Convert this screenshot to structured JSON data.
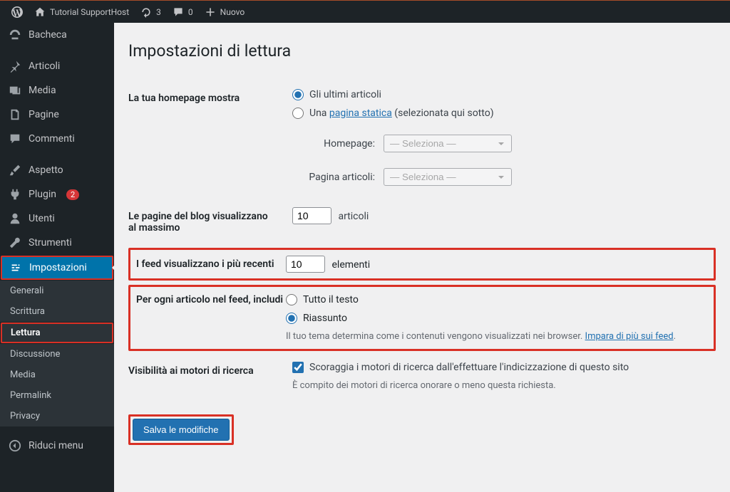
{
  "toolbar": {
    "site_name": "Tutorial SupportHost",
    "updates_count": "3",
    "comments_count": "0",
    "new_label": "Nuovo"
  },
  "sidebar": {
    "dashboard": "Bacheca",
    "posts": "Articoli",
    "media": "Media",
    "pages": "Pagine",
    "comments": "Commenti",
    "appearance": "Aspetto",
    "plugins": "Plugin",
    "plugins_badge": "2",
    "users": "Utenti",
    "tools": "Strumenti",
    "settings": "Impostazioni",
    "sub": {
      "general": "Generali",
      "writing": "Scrittura",
      "reading": "Lettura",
      "discussion": "Discussione",
      "media": "Media",
      "permalink": "Permalink",
      "privacy": "Privacy"
    },
    "collapse": "Riduci menu"
  },
  "page": {
    "title": "Impostazioni di lettura",
    "homepage_label": "La tua homepage mostra",
    "homepage_opt_latest": "Gli ultimi articoli",
    "homepage_opt_static_prefix": "Una ",
    "homepage_opt_static_link": "pagina statica",
    "homepage_opt_static_suffix": " (selezionata qui sotto)",
    "homepage_select_label": "Homepage:",
    "posts_page_select_label": "Pagina articoli:",
    "select_placeholder": "— Seleziona —",
    "blog_pages_label": "Le pagine del blog visualizzano al massimo",
    "blog_pages_value": "10",
    "blog_pages_suffix": "articoli",
    "feed_items_label": "I feed visualizzano i più recenti",
    "feed_items_value": "10",
    "feed_items_suffix": "elementi",
    "feed_include_label": "Per ogni articolo nel feed, includi",
    "feed_include_full": "Tutto il testo",
    "feed_include_summary": "Riassunto",
    "feed_desc_prefix": "Il tuo tema determina come i contenuti vengono visualizzati nei browser. ",
    "feed_desc_link": "Impara di più sui feed",
    "search_vis_label": "Visibilità ai motori di ricerca",
    "search_vis_check": "Scoraggia i motori di ricerca dall'effettuare l'indicizzazione di questo sito",
    "search_vis_desc": "È compito dei motori di ricerca onorare o meno questa richiesta.",
    "submit": "Salva le modifiche"
  }
}
